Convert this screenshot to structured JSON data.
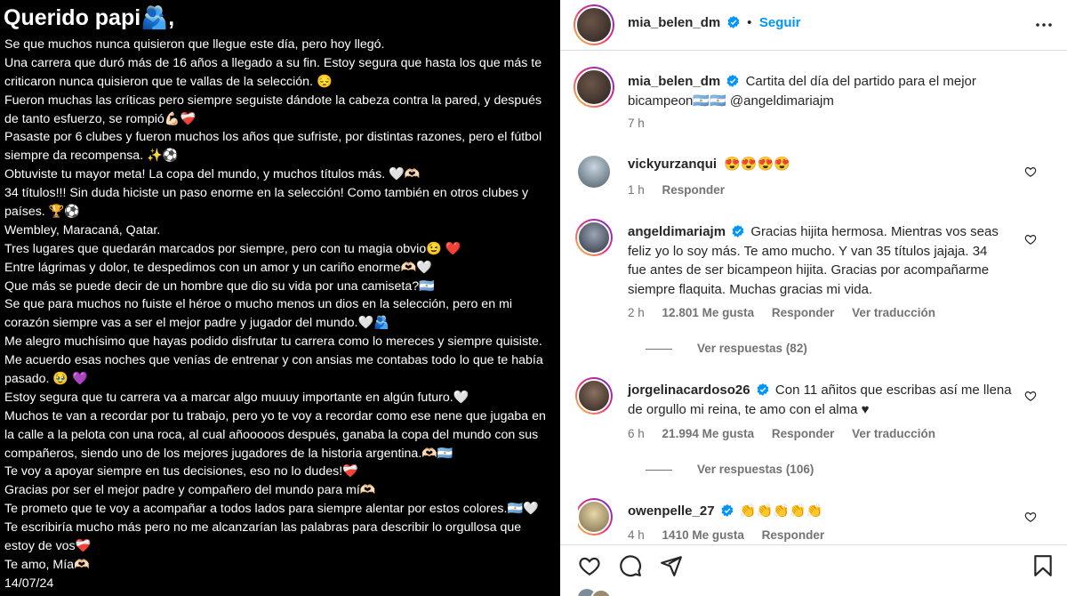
{
  "letter": {
    "title": "Querido papi🫂,",
    "lines": [
      "Se que muchos nunca quisieron que llegue este día, pero hoy llegó.",
      "Una carrera que duró más de 16 años a llegado a su fin. Estoy segura que hasta los que más te",
      "criticaron nunca quisieron que te vallas de la selección. 😔",
      "Fueron muchas las críticas pero siempre seguiste dándote la cabeza contra la pared, y después",
      "de tanto esfuerzo, se rompió💪🏻❤️‍🩹",
      "Pasaste por 6 clubes y fueron muchos los años que sufriste, por distintas razones, pero el fútbol",
      "siempre da recompensa. ✨⚽",
      "Obtuviste tu mayor meta! La copa del mundo, y muchos títulos más.        🤍🫶🏻",
      " 34 títulos!!! Sin duda hiciste un paso enorme en la selección! Como también en otros clubes y",
      "países. 🏆⚽",
      "Wembley, Maracaná, Qatar.",
      "Tres lugares que quedarán marcados por siempre, pero con  tu magia obvio😉 ❤️",
      " Entre lágrimas y dolor, te despedimos con un amor y un cariño enorme🫶🏻🤍",
      " Que más se puede decir de un hombre que dio su vida por una  camiseta?🇦🇷",
      "Se que para muchos no fuiste el héroe o mucho menos un dios en la selección, pero en mi",
      "corazón siempre vas a ser el mejor padre y jugador del mundo.🤍🫂",
      "Me alegro muchísimo que hayas podido disfrutar tu carrera como lo mereces y siempre quisiste.",
      "Me acuerdo esas noches que venías de entrenar y con ansias me contabas todo lo que te había",
      "pasado. 🥹 💜",
      "Estoy segura que tu carrera va a marcar algo muuuy importante en algún futuro.🤍",
      "Muchos te van a recordar por tu trabajo, pero yo te voy a recordar como ese nene que jugaba en",
      "la calle a la pelota con una roca, al cual añooooos después, ganaba la copa del mundo con sus",
      "compañeros, siendo uno de los mejores jugadores de la historia argentina.🫶🏻🇦🇷",
      "Te voy a apoyar siempre en tus decisiones, eso no lo dudes!❤️‍🩹",
      "Gracias por ser el mejor padre y compañero del mundo para mí🫶🏻",
      "Te prometo que te voy a acompañar a todos lados para siempre alentar por estos colores.🇦🇷🤍",
      "Te escribiría mucho más pero no me alcanzarían las palabras para describir lo orgullosa que",
      "estoy de vos❤️‍🩹",
      "Te amo, Mía🫶🏻",
      "14/07/24"
    ]
  },
  "header": {
    "username": "mia_belen_dm",
    "follow_label": "Seguir"
  },
  "caption": {
    "username": "mia_belen_dm",
    "text_line1": "Cartita del día del partido para el mejor",
    "text_line2": "bicampeon🇦🇷🇦🇷 @angeldimariajm",
    "time": "7 h"
  },
  "comments": [
    {
      "username": "vickyurzanqui",
      "verified": false,
      "lines": [
        "😍😍😍😍"
      ],
      "time": "1 h",
      "likes": "",
      "reply_label": "Responder",
      "translate_label": "",
      "replies_label": ""
    },
    {
      "username": "angeldimariajm",
      "verified": true,
      "lines": [
        "Gracias hijita hermosa. Mientras vos seas",
        "feliz yo lo soy más. Te amo mucho. Y van 35 títulos jajaja. 34",
        "fue antes de ser bicampeon hijita. Gracias por acompañarme",
        "siempre flaquita. Muchas gracias mi vida."
      ],
      "time": "2 h",
      "likes": "12.801 Me gusta",
      "reply_label": "Responder",
      "translate_label": "Ver traducción",
      "replies_label": "Ver respuestas (82)"
    },
    {
      "username": "jorgelinacardoso26",
      "verified": true,
      "lines": [
        "Con 11 añitos que escribas así me llena",
        "de orgullo mi reina, te amo con el alma ♥"
      ],
      "time": "6 h",
      "likes": "21.994 Me gusta",
      "reply_label": "Responder",
      "translate_label": "Ver traducción",
      "replies_label": "Ver respuestas (106)"
    },
    {
      "username": "owenpelle_27",
      "verified": true,
      "lines": [
        "👏👏👏👏👏"
      ],
      "time": "4 h",
      "likes": "1410 Me gusta",
      "reply_label": "Responder",
      "translate_label": "",
      "replies_label": ""
    }
  ],
  "colors": {
    "accent": "#0095f6",
    "text": "#262626",
    "muted": "#737373",
    "border": "#dbdbdb"
  },
  "icons": [
    "more-icon",
    "verified-icon",
    "heart-icon",
    "comment-icon",
    "share-icon",
    "bookmark-icon"
  ]
}
